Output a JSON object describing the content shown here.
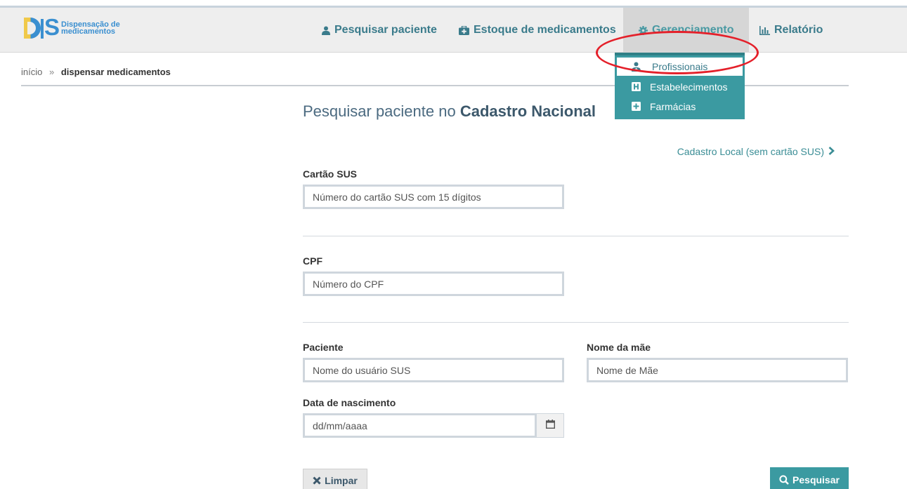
{
  "app": {
    "logo_text_line1": "Dispensação de",
    "logo_text_line2": "medicamentos"
  },
  "nav": {
    "items": [
      {
        "label": "Pesquisar paciente",
        "icon": "user-icon"
      },
      {
        "label": "Estoque de medicamentos",
        "icon": "briefcase-medical-icon"
      },
      {
        "label": "Gerenciamento",
        "icon": "gear-icon",
        "active": true
      },
      {
        "label": "Relatório",
        "icon": "bar-chart-icon"
      }
    ]
  },
  "dropdown": {
    "items": [
      {
        "label": "Profissionais",
        "icon": "user-md-icon",
        "highlighted": true
      },
      {
        "label": "Estabelecimentos",
        "icon": "hospital-h-icon"
      },
      {
        "label": "Farmácias",
        "icon": "plus-square-icon"
      }
    ]
  },
  "breadcrumb": {
    "home": "início",
    "separator": "»",
    "current": "dispensar medicamentos"
  },
  "page": {
    "title_prefix": "Pesquisar paciente no ",
    "title_bold": "Cadastro Nacional",
    "local_link": "Cadastro Local (sem cartão SUS)"
  },
  "form": {
    "cartao_sus": {
      "label": "Cartão SUS",
      "placeholder": "Número do cartão SUS com 15 dígitos"
    },
    "cpf": {
      "label": "CPF",
      "placeholder": "Número do CPF"
    },
    "paciente": {
      "label": "Paciente",
      "placeholder": "Nome do usuário SUS"
    },
    "nome_mae": {
      "label": "Nome da mãe",
      "placeholder": "Nome de Mãe"
    },
    "data_nascimento": {
      "label": "Data de nascimento",
      "placeholder": "dd/mm/aaaa"
    }
  },
  "actions": {
    "clear_label": "Limpar",
    "search_label": "Pesquisar"
  },
  "colors": {
    "accent": "#3b9aa1",
    "nav_text": "#3a7b8b",
    "annotation": "#e4202a"
  }
}
